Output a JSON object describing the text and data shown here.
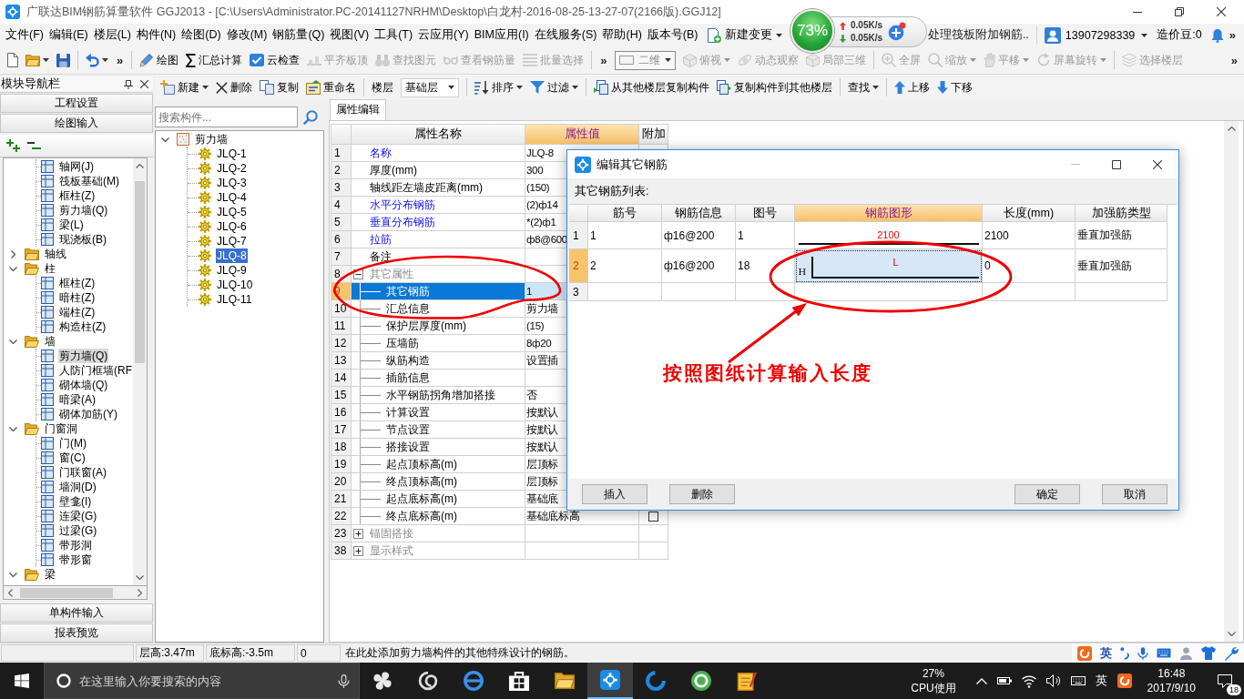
{
  "window": {
    "title": "广联达BIM钢筋算量软件 GGJ2013 - [C:\\Users\\Administrator.PC-20141127NRHM\\Desktop\\白龙村-2016-08-25-13-27-07(2166版).GGJ12]"
  },
  "menu": [
    "文件(F)",
    "编辑(E)",
    "楼层(L)",
    "构件(N)",
    "绘图(D)",
    "修改(M)",
    "钢筋量(Q)",
    "视图(V)",
    "工具(T)",
    "云应用(Y)",
    "BIM应用(I)",
    "在线服务(S)",
    "帮助(H)",
    "版本号(B)"
  ],
  "menu_right": {
    "change": "新建变更",
    "notice": "处理筏板附加钢筋..",
    "account": "13907298339",
    "beans": "造价豆:0",
    "more": "»"
  },
  "speed_widget": {
    "percent": "73%",
    "up": "0.05K/s",
    "down": "0.05K/s"
  },
  "toolbar": [
    {
      "items": [
        {
          "kind": "icon",
          "disabled": false,
          "dropdown": false
        },
        {
          "kind": "icon",
          "disabled": false,
          "dropdown": true
        },
        {
          "kind": "icon",
          "disabled": false,
          "dropdown": false
        }
      ]
    },
    {
      "items": [
        {
          "kind": "icon",
          "disabled": false,
          "dropdown": true
        },
        {
          "kind": "more",
          "label": "»"
        }
      ]
    },
    {
      "items": [
        {
          "kind": "button",
          "label": "绘图",
          "disabled": false,
          "dropdown": false
        },
        {
          "kind": "button",
          "label": "汇总计算",
          "disabled": false,
          "dropdown": false
        },
        {
          "kind": "button",
          "label": "云检查",
          "disabled": false,
          "dropdown": false
        },
        {
          "kind": "button",
          "label": "平齐板顶",
          "disabled": true,
          "dropdown": false
        },
        {
          "kind": "button",
          "label": "查找图元",
          "disabled": true,
          "dropdown": false
        },
        {
          "kind": "button",
          "label": "查看钢筋量",
          "disabled": true,
          "dropdown": false
        },
        {
          "kind": "button",
          "label": "批量选择",
          "disabled": true,
          "dropdown": false
        }
      ]
    },
    {
      "items": [
        {
          "kind": "more",
          "label": "»"
        },
        {
          "kind": "select",
          "label": "二维",
          "disabled": true
        },
        {
          "kind": "button",
          "label": "俯视",
          "disabled": true,
          "dropdown": true
        },
        {
          "kind": "button",
          "label": "动态观察",
          "disabled": true,
          "dropdown": false
        },
        {
          "kind": "button",
          "label": "局部三维",
          "disabled": true,
          "dropdown": false
        }
      ]
    },
    {
      "items": [
        {
          "kind": "button",
          "label": "全屏",
          "disabled": true,
          "dropdown": false
        },
        {
          "kind": "button",
          "label": "缩放",
          "disabled": true,
          "dropdown": true
        },
        {
          "kind": "button",
          "label": "平移",
          "disabled": true,
          "dropdown": true
        },
        {
          "kind": "button",
          "label": "屏幕旋转",
          "disabled": true,
          "dropdown": true
        }
      ]
    },
    {
      "items": [
        {
          "kind": "button",
          "label": "选择楼层",
          "disabled": true,
          "dropdown": false
        }
      ]
    }
  ],
  "toolbar_more": "»",
  "list_toolbar": [
    {
      "items": [
        {
          "kind": "button",
          "label": "新建",
          "disabled": false,
          "dropdown": true
        },
        {
          "kind": "button",
          "label": "删除",
          "disabled": false,
          "dropdown": false
        },
        {
          "kind": "button",
          "label": "复制",
          "disabled": false,
          "dropdown": false
        },
        {
          "kind": "button",
          "label": "重命名",
          "disabled": false,
          "dropdown": false
        }
      ]
    },
    {
      "items": [
        {
          "kind": "label",
          "label": "楼层"
        },
        {
          "kind": "select",
          "label": "基础层",
          "disabled": false
        }
      ]
    },
    {
      "items": [
        {
          "kind": "button",
          "label": "排序",
          "disabled": false,
          "dropdown": true
        },
        {
          "kind": "button",
          "label": "过滤",
          "disabled": false,
          "dropdown": true
        }
      ]
    },
    {
      "items": [
        {
          "kind": "button",
          "label": "从其他楼层复制构件",
          "disabled": false,
          "dropdown": false
        },
        {
          "kind": "button",
          "label": "复制构件到其他楼层",
          "disabled": false,
          "dropdown": false
        }
      ]
    },
    {
      "items": [
        {
          "kind": "button",
          "label": "查找",
          "disabled": false,
          "dropdown": true
        }
      ]
    },
    {
      "items": [
        {
          "kind": "button",
          "label": "上移",
          "disabled": false,
          "dropdown": false
        },
        {
          "kind": "button",
          "label": "下移",
          "disabled": false,
          "dropdown": false
        }
      ]
    }
  ],
  "nav": {
    "title": "模块导航栏",
    "top_buttons": [
      "工程设置",
      "绘图输入"
    ],
    "tree_continued": [
      {
        "label": "轴网(J)",
        "selected": false
      },
      {
        "label": "筏板基础(M)",
        "selected": false
      },
      {
        "label": "框柱(Z)",
        "selected": false
      },
      {
        "label": "剪力墙(Q)",
        "selected": false
      },
      {
        "label": "梁(L)",
        "selected": false
      },
      {
        "label": "现浇板(B)",
        "selected": false
      }
    ],
    "tree": [
      {
        "label": "轴线",
        "expanded": false
      },
      {
        "label": "柱",
        "expanded": true,
        "children": [
          {
            "label": "框柱(Z)",
            "selected": false
          },
          {
            "label": "暗柱(Z)",
            "selected": false
          },
          {
            "label": "端柱(Z)",
            "selected": false
          },
          {
            "label": "构造柱(Z)",
            "selected": false
          }
        ]
      },
      {
        "label": "墙",
        "expanded": true,
        "children": [
          {
            "label": "剪力墙(Q)",
            "selected": true
          },
          {
            "label": "人防门框墙(RF",
            "selected": false
          },
          {
            "label": "砌体墙(Q)",
            "selected": false
          },
          {
            "label": "暗梁(A)",
            "selected": false
          },
          {
            "label": "砌体加筋(Y)",
            "selected": false
          }
        ]
      },
      {
        "label": "门窗洞",
        "expanded": true,
        "children": [
          {
            "label": "门(M)",
            "selected": false
          },
          {
            "label": "窗(C)",
            "selected": false
          },
          {
            "label": "门联窗(A)",
            "selected": false
          },
          {
            "label": "墙洞(D)",
            "selected": false
          },
          {
            "label": "壁龛(I)",
            "selected": false
          },
          {
            "label": "连梁(G)",
            "selected": false
          },
          {
            "label": "过梁(G)",
            "selected": false
          },
          {
            "label": "带形洞",
            "selected": false
          },
          {
            "label": "带形窗",
            "selected": false
          }
        ]
      },
      {
        "label": "梁",
        "expanded": true
      }
    ],
    "bottom_buttons": [
      "单构件输入",
      "报表预览"
    ]
  },
  "components": {
    "search_placeholder": "搜索构件...",
    "tree": [
      {
        "label": "剪力墙",
        "expanded": true,
        "children": [
          {
            "label": "JLQ-1",
            "selected": false
          },
          {
            "label": "JLQ-2",
            "selected": false
          },
          {
            "label": "JLQ-3",
            "selected": false
          },
          {
            "label": "JLQ-4",
            "selected": false
          },
          {
            "label": "JLQ-5",
            "selected": false
          },
          {
            "label": "JLQ-6",
            "selected": false
          },
          {
            "label": "JLQ-7",
            "selected": false
          },
          {
            "label": "JLQ-8",
            "selected": true
          },
          {
            "label": "JLQ-9",
            "selected": false
          },
          {
            "label": "JLQ-10",
            "selected": false
          },
          {
            "label": "JLQ-11",
            "selected": false
          }
        ]
      }
    ]
  },
  "properties": {
    "tabs": [
      {
        "label": "属性编辑",
        "selected": true
      }
    ],
    "columns": [
      {
        "label": "属性名称",
        "selected": false
      },
      {
        "label": "属性值",
        "selected": true
      },
      {
        "label": "附加",
        "selected": false
      }
    ],
    "rows": [
      {
        "no": "1",
        "name": "名称",
        "value": "JLQ-8",
        "kind": "key",
        "selected": false
      },
      {
        "no": "2",
        "name": "厚度(mm)",
        "value": "300",
        "kind": "plain",
        "selected": false
      },
      {
        "no": "3",
        "name": "轴线距左墙皮距离(mm)",
        "value": "(150)",
        "kind": "plain",
        "selected": false
      },
      {
        "no": "4",
        "name": "水平分布钢筋",
        "value": "(2)ф14",
        "kind": "key",
        "selected": false
      },
      {
        "no": "5",
        "name": "垂直分布钢筋",
        "value": "*(2)ф1",
        "kind": "key",
        "selected": false
      },
      {
        "no": "6",
        "name": "拉筋",
        "value": "ф8@600",
        "kind": "key",
        "selected": false
      },
      {
        "no": "7",
        "name": "备注",
        "kind": "plain",
        "selected": false
      },
      {
        "no": "8",
        "name": "其它属性",
        "kind": "group",
        "expanded": true,
        "selected": false,
        "children": [
          {
            "no": "9",
            "name": "其它钢筋",
            "value": "1",
            "kind": "plain",
            "selected": true
          },
          {
            "no": "10",
            "name": "汇总信息",
            "value": "剪力墙",
            "kind": "plain",
            "selected": false
          },
          {
            "no": "11",
            "name": "保护层厚度(mm)",
            "value": "(15)",
            "kind": "plain",
            "selected": false
          },
          {
            "no": "12",
            "name": "压墙筋",
            "value": "8ф20",
            "kind": "plain",
            "selected": false
          },
          {
            "no": "13",
            "name": "纵筋构造",
            "value": "设置插",
            "kind": "plain",
            "selected": false
          },
          {
            "no": "14",
            "name": "插筋信息",
            "kind": "plain",
            "selected": false
          },
          {
            "no": "15",
            "name": "水平钢筋拐角增加搭接",
            "value": "否",
            "kind": "plain",
            "selected": false
          },
          {
            "no": "16",
            "name": "计算设置",
            "value": "按默认",
            "kind": "plain",
            "selected": false
          },
          {
            "no": "17",
            "name": "节点设置",
            "value": "按默认",
            "kind": "plain",
            "selected": false
          },
          {
            "no": "18",
            "name": "搭接设置",
            "value": "按默认",
            "kind": "plain",
            "selected": false
          },
          {
            "no": "19",
            "name": "起点顶标高(m)",
            "value": "层顶标",
            "kind": "plain",
            "selected": false
          },
          {
            "no": "20",
            "name": "终点顶标高(m)",
            "value": "层顶标",
            "kind": "plain",
            "selected": false
          },
          {
            "no": "21",
            "name": "起点底标高(m)",
            "value": "基础底",
            "kind": "plain",
            "selected": false
          },
          {
            "no": "22",
            "name": "终点底标高(m)",
            "value": "基础底标高",
            "kind": "plain",
            "selected": false,
            "extra_checked": false
          }
        ]
      },
      {
        "no": "23",
        "name": "锚固搭接",
        "kind": "group",
        "expanded": false,
        "selected": false
      },
      {
        "no": "38",
        "name": "显示样式",
        "kind": "group",
        "expanded": false,
        "selected": false
      }
    ]
  },
  "dialog": {
    "title": "编辑其它钢筋",
    "minimize_disabled": true,
    "list_label": "其它钢筋列表:",
    "columns": [
      {
        "label": "筋号",
        "selected": false
      },
      {
        "label": "钢筋信息",
        "selected": false
      },
      {
        "label": "图号",
        "selected": false
      },
      {
        "label": "钢筋图形",
        "selected": true
      },
      {
        "label": "长度(mm)",
        "selected": false
      },
      {
        "label": "加强筋类型",
        "selected": false
      }
    ],
    "rows": [
      {
        "no": "1",
        "bar_no": "1",
        "info": "ф16@200",
        "shape_no": "1",
        "shape": {
          "kind": "straight",
          "length": "2100"
        },
        "length": "2100",
        "type": "垂直加强筋",
        "selected": false
      },
      {
        "no": "2",
        "bar_no": "2",
        "info": "ф16@200",
        "shape_no": "18",
        "shape": {
          "kind": "hook",
          "height": "H",
          "length": "L"
        },
        "length": "0",
        "type": "垂直加强筋",
        "selected": true
      },
      {
        "no": "3",
        "selected": false
      }
    ],
    "buttons_left": [
      "插入",
      "删除"
    ],
    "buttons_right": [
      "确定",
      "取消"
    ]
  },
  "annotation": {
    "note": "按照图纸计算输入长度"
  },
  "status_bar": {
    "cells": [
      "层高:3.47m",
      "底标高:-3.5m",
      "0"
    ],
    "message": "在此处添加剪力墙构件的其他特殊设计的钢筋。",
    "ime": "英"
  },
  "taskbar": {
    "search_placeholder": "在这里输入你要搜索的内容",
    "apps": [
      {
        "selected": false
      },
      {
        "selected": false
      },
      {
        "selected": false
      },
      {
        "selected": false
      },
      {
        "selected": false
      },
      {
        "selected": true
      },
      {
        "selected": false
      },
      {
        "selected": false
      },
      {
        "selected": false
      }
    ],
    "cpu_value": "27%",
    "cpu_label": "CPU使用",
    "ime": "英",
    "time": "16:48",
    "date": "2017/9/10",
    "notifications": "18"
  }
}
